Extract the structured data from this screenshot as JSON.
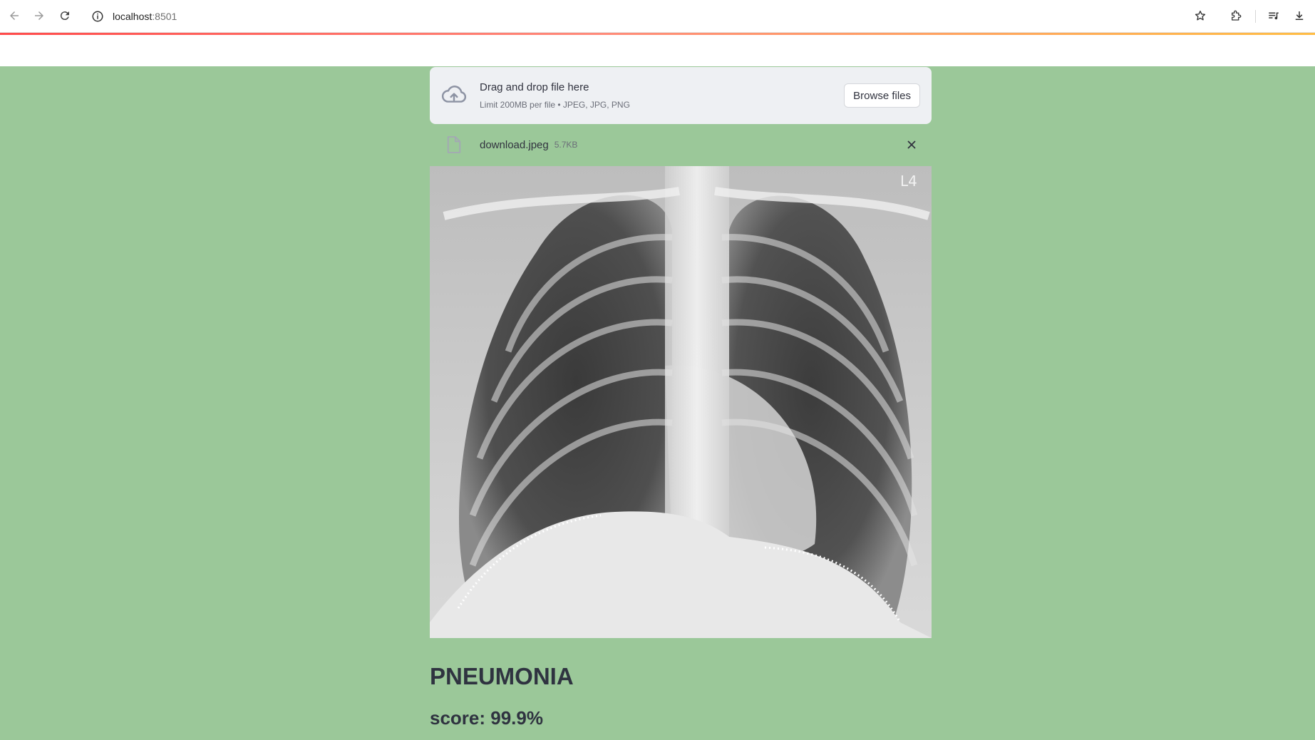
{
  "browser": {
    "url_host": "localhost",
    "url_port": ":8501",
    "icons": [
      "back-icon",
      "forward-icon",
      "reload-icon",
      "site-info-icon",
      "bookmark-star-icon",
      "extensions-icon",
      "media-controls-icon",
      "download-icon"
    ]
  },
  "uploader": {
    "title": "Drag and drop file here",
    "subtitle": "Limit 200MB per file • JPEG, JPG, PNG",
    "browse_label": "Browse files",
    "icon": "cloud-upload-icon"
  },
  "uploaded_file": {
    "name": "download.jpeg",
    "size": "5.7KB",
    "icon": "file-icon",
    "remove_icon": "close-icon"
  },
  "image": {
    "subject": "chest-xray",
    "overlay_text": "L4"
  },
  "result": {
    "label": "PNEUMONIA",
    "score": "score: 99.9%"
  },
  "colors": {
    "page_background": "#9bc899",
    "text": "#2f3340",
    "accent_gradient_start": "#ff4b4b",
    "accent_gradient_end": "#ffbd45"
  }
}
